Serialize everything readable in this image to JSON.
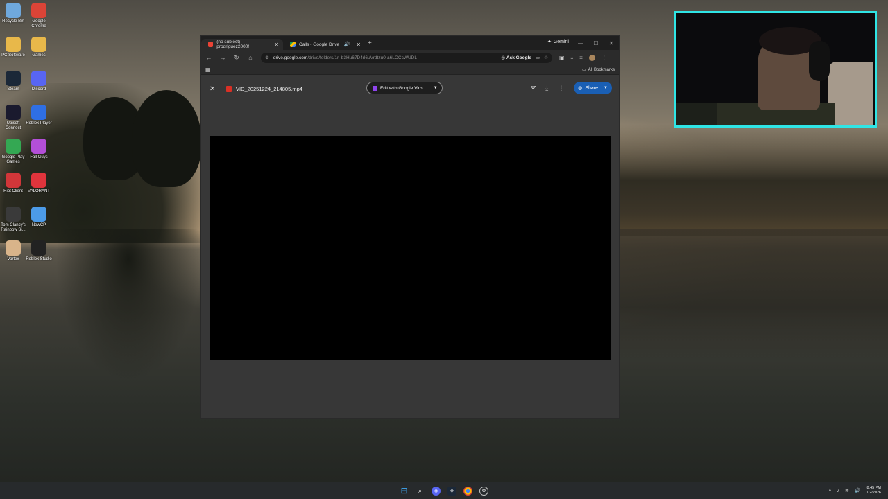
{
  "desktop": {
    "icons": [
      {
        "label": "Recycle Bin",
        "icon": "recycle-bin-icon",
        "color": "#6fa8dc"
      },
      {
        "label": "Google Chrome",
        "icon": "chrome-icon",
        "color": "#db4437"
      },
      {
        "label": "PC Software",
        "icon": "folder-icon",
        "color": "#e8b84a"
      },
      {
        "label": "Games",
        "icon": "folder-icon",
        "color": "#e8b84a"
      },
      {
        "label": "Steam",
        "icon": "steam-icon",
        "color": "#1b2838"
      },
      {
        "label": "Discord",
        "icon": "discord-icon",
        "color": "#5865f2"
      },
      {
        "label": "Ubisoft Connect",
        "icon": "ubisoft-icon",
        "color": "#1a1a2e"
      },
      {
        "label": "Roblox Player",
        "icon": "roblox-player-icon",
        "color": "#2f6fe4"
      },
      {
        "label": "Google Play Games",
        "icon": "google-play-games-icon",
        "color": "#34a853"
      },
      {
        "label": "Fall Guys",
        "icon": "fall-guys-icon",
        "color": "#b34fd8"
      },
      {
        "label": "Riot Client",
        "icon": "riot-client-icon",
        "color": "#d13639"
      },
      {
        "label": "VALORANT",
        "icon": "valorant-icon",
        "color": "#e0343c"
      },
      {
        "label": "Tom Clancy's Rainbow Si...",
        "icon": "rainbow-six-icon",
        "color": "#3a3a3a"
      },
      {
        "label": "NewCP",
        "icon": "newcp-icon",
        "color": "#4c9be8"
      },
      {
        "label": "Vortex",
        "icon": "vortex-icon",
        "color": "#d9b48a"
      },
      {
        "label": "Roblox Studio",
        "icon": "roblox-studio-icon",
        "color": "#222222"
      }
    ]
  },
  "browser": {
    "tabs": [
      {
        "title": "(no subject) - prodriguez2000!",
        "icon": "gmail-icon",
        "active": true
      },
      {
        "title": "Calls - Google Drive",
        "icon": "google-drive-icon",
        "active": false
      }
    ],
    "gemini_label": "Gemini",
    "url_host": "drive.google.com",
    "url_rest": "/drive/folders/1r_b3Hu67D4rl6uVrdtzu0-a6LOCcWUDL",
    "ask_google_label": "Ask Google",
    "all_bookmarks_label": "All Bookmarks"
  },
  "viewer": {
    "file_name": "VID_20251224_214805.mp4",
    "edit_vids_label": "Edit with Google Vids",
    "share_label": "Share"
  },
  "taskbar": {
    "time": "8:45 PM",
    "date": "1/2/2026"
  },
  "colors": {
    "webcam_border": "#2fe5e5",
    "share_button": "#1a5fb4",
    "video_background": "#000000"
  }
}
